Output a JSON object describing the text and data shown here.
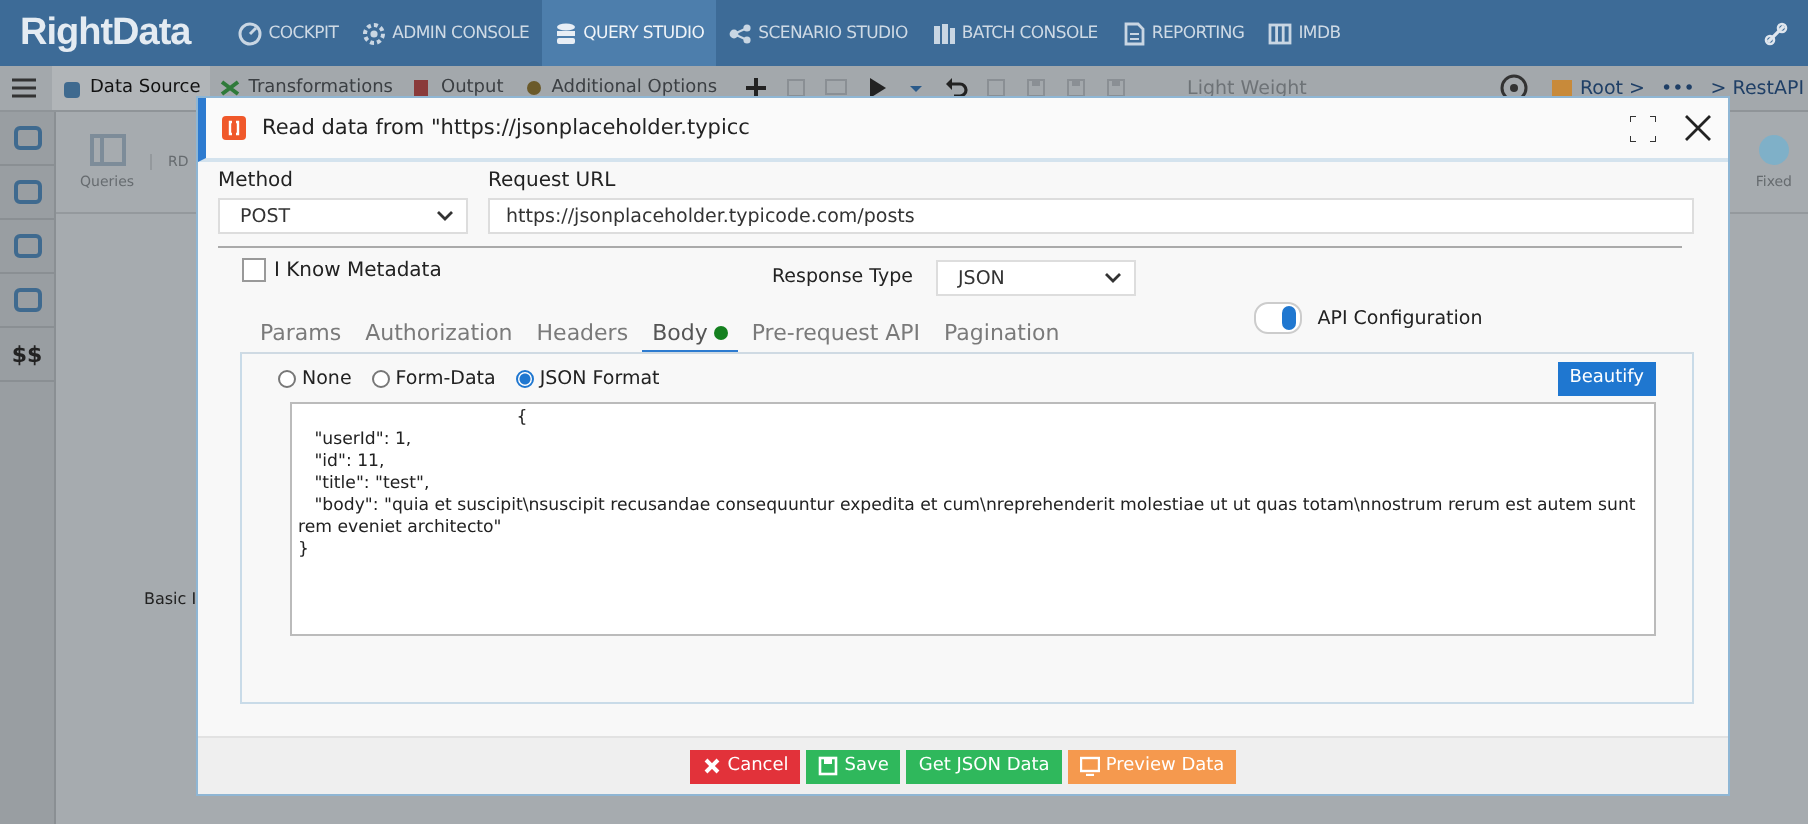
{
  "app": {
    "logo": "RightData",
    "nav": [
      {
        "label": "COCKPIT",
        "selected": false
      },
      {
        "label": "ADMIN CONSOLE",
        "selected": false
      },
      {
        "label": "QUERY STUDIO",
        "selected": true
      },
      {
        "label": "SCENARIO STUDIO",
        "selected": false
      },
      {
        "label": "BATCH CONSOLE",
        "selected": false
      },
      {
        "label": "REPORTING",
        "selected": false
      },
      {
        "label": "IMDB",
        "selected": false
      }
    ],
    "tabs": [
      {
        "label": "Data Source",
        "selected": true
      },
      {
        "label": "Transformations",
        "selected": false
      },
      {
        "label": "Output",
        "selected": false
      },
      {
        "label": "Additional Options",
        "selected": false
      }
    ],
    "mode_label": "Light Weight",
    "breadcrumb": [
      {
        "label": "Root >"
      },
      {
        "label": "•••"
      },
      {
        "label": "> RestAPI"
      }
    ],
    "sidebar_text": "$$",
    "ribbon": [
      {
        "label": "Queries"
      },
      {
        "label": "RD"
      }
    ],
    "ribbon_right": "Fixed",
    "canvas_label": "Basic I"
  },
  "dialog": {
    "title": "Read data from \"https://jsonplaceholder.typicc",
    "method": {
      "label": "Method",
      "value": "POST"
    },
    "url": {
      "label": "Request URL",
      "value": "https://jsonplaceholder.typicode.com/posts"
    },
    "know_metadata": {
      "label": "I Know Metadata",
      "checked": false
    },
    "response_type": {
      "label": "Response Type",
      "value": "JSON"
    },
    "tabs": [
      {
        "label": "Params",
        "selected": false,
        "has_content": false
      },
      {
        "label": "Authorization",
        "selected": false,
        "has_content": false
      },
      {
        "label": "Headers",
        "selected": false,
        "has_content": false
      },
      {
        "label": "Body",
        "selected": true,
        "has_content": true
      },
      {
        "label": "Pre-request API",
        "selected": false,
        "has_content": false
      },
      {
        "label": "Pagination",
        "selected": false,
        "has_content": false
      }
    ],
    "api_configuration": {
      "label": "API Configuration",
      "on": true
    },
    "body_formats": [
      {
        "label": "None",
        "selected": false
      },
      {
        "label": "Form-Data",
        "selected": false
      },
      {
        "label": "JSON Format",
        "selected": true
      }
    ],
    "beautify": "Beautify",
    "body_text": "                                        {\n   \"userId\": 1,\n   \"id\": 11,\n   \"title\": \"test\",\n   \"body\": \"quia et suscipit\\nsuscipit recusandae consequuntur expedita et cum\\nreprehenderit molestiae ut ut quas totam\\nnostrum rerum est autem sunt rem eveniet architecto\"\n}",
    "buttons": [
      {
        "label": "Cancel",
        "kind": "cancel"
      },
      {
        "label": "Save",
        "kind": "save"
      },
      {
        "label": "Get JSON Data",
        "kind": "get"
      },
      {
        "label": "Preview Data",
        "kind": "preview"
      }
    ]
  }
}
